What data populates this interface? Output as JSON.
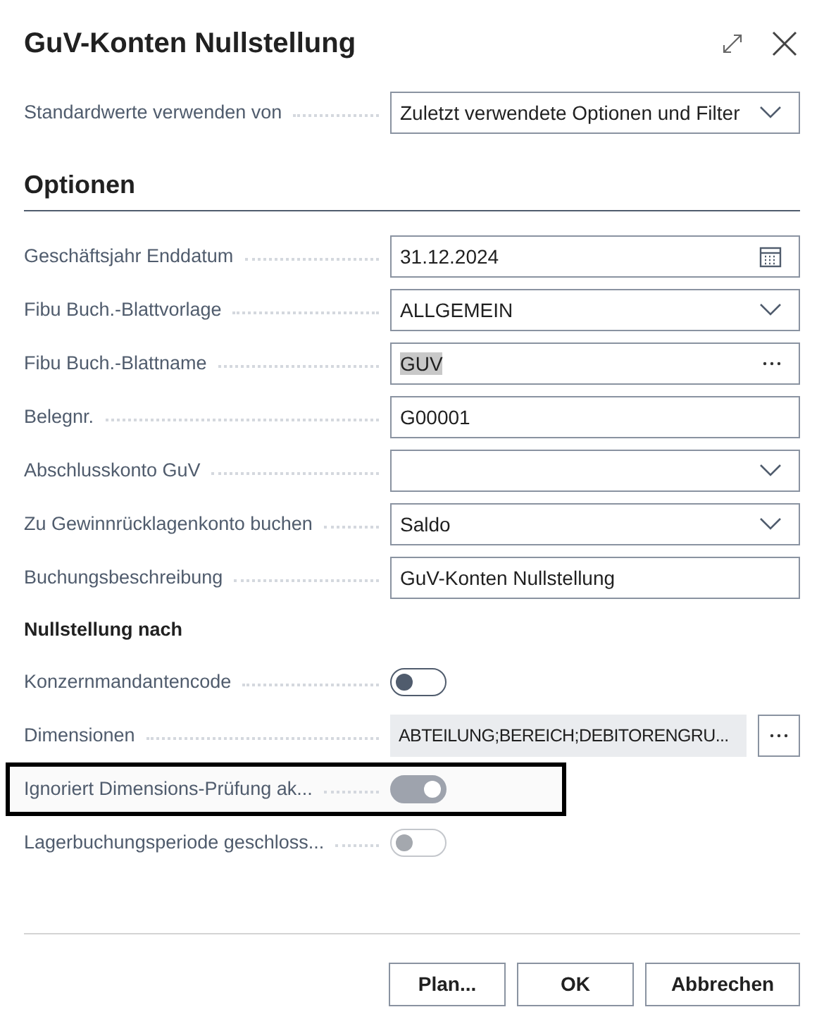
{
  "window": {
    "title": "GuV-Konten Nullstellung"
  },
  "defaults": {
    "label": "Standardwerte verwenden von",
    "kind": "dropdown",
    "value": "Zuletzt verwendete Optionen und Filter"
  },
  "section": {
    "title": "Optionen"
  },
  "fields": [
    {
      "label": "Geschäftsjahr Enddatum",
      "kind": "date",
      "value": "31.12.2024"
    },
    {
      "label": "Fibu Buch.-Blattvorlage",
      "kind": "dropdown",
      "value": "ALLGEMEIN"
    },
    {
      "label": "Fibu Buch.-Blattname",
      "kind": "lookup",
      "value": "GUV",
      "value_selected": true
    },
    {
      "label": "Belegnr.",
      "kind": "text",
      "value": "G00001"
    },
    {
      "label": "Abschlusskonto GuV",
      "kind": "dropdown"
    },
    {
      "label": "Zu Gewinnrücklagenkonto buchen",
      "kind": "dropdown",
      "value": "Saldo"
    },
    {
      "label": "Buchungsbeschreibung",
      "kind": "text",
      "value": "GuV-Konten Nullstellung"
    }
  ],
  "subsection": {
    "title": "Nullstellung nach"
  },
  "reset_fields": [
    {
      "label": "Konzernmandantencode",
      "kind": "toggle",
      "on": false,
      "disabled": false,
      "highlighted": false
    },
    {
      "label": "Dimensionen",
      "kind": "readonly",
      "value": "ABTEILUNG;BEREICH;DEBITORENGRU...",
      "highlighted": false
    },
    {
      "label": "Ignoriert Dimensions-Prüfung ak...",
      "kind": "toggle",
      "on": true,
      "disabled": true,
      "highlighted": true
    },
    {
      "label": "Lagerbuchungsperiode geschloss...",
      "kind": "toggle",
      "on": false,
      "disabled": true,
      "highlighted": false
    }
  ],
  "buttons": [
    {
      "label": "Plan..."
    },
    {
      "label": "OK"
    },
    {
      "label": "Abbrechen"
    }
  ]
}
